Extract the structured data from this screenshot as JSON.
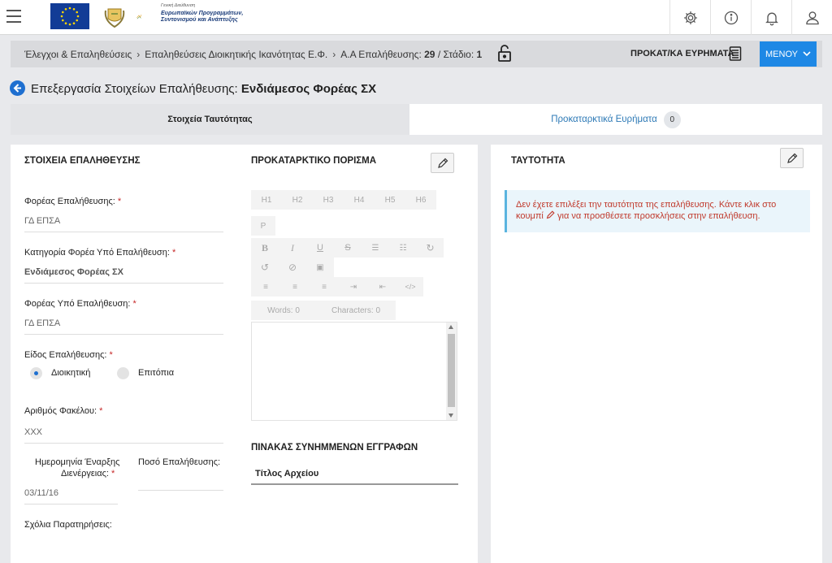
{
  "header": {
    "logo_lines": [
      "Γενική Διεύθυνση",
      "Ευρωπαϊκών Προγραμμάτων,",
      "Συντονισμού και Ανάπτυξης"
    ],
    "icons": [
      "menu-icon",
      "eu-flag-logo",
      "cyprus-emblem-logo",
      "settings-icon",
      "info-icon",
      "bell-icon",
      "user-icon"
    ]
  },
  "breadcrumb": {
    "item1": "Έλεγχοι & Επαληθεύσεις",
    "item2": "Επαληθεύσεις Διοικητικής Ικανότητας Ε.Φ.",
    "item3_prefix": "Α.Α Επαλήθευσης: ",
    "item3_number": "29",
    "item3_stage_label": " / Στάδιο: ",
    "item3_stage": "1",
    "findings_link": "ΠΡΟΚΑΤ/ΚΑ ΕΥΡΗΜΑΤΑ",
    "menu_button": "ΜΕΝΟΥ"
  },
  "page": {
    "title_prefix": "Επεξεργασία Στοιχείων Επαλήθευσης: ",
    "title_entity": "Ενδιάμεσος Φορέας ΣΧ"
  },
  "tabs": [
    {
      "label": "Στοιχεία Ταυτότητας",
      "active": true
    },
    {
      "label": "Προκαταρκτικά Ευρήματα",
      "count": "0",
      "active": false
    }
  ],
  "form": {
    "section_title": "ΣΤΟΙΧΕΙΑ ΕΠΑΛΗΘΕΥΣΗΣ",
    "carrier_label": "Φορέας Επαλήθευσης:",
    "carrier_value": "ΓΔ ΕΠΣΑ",
    "category_label": "Κατηγορία Φορέα Υπό Επαλήθευση:",
    "category_value": "Ενδιάμεσος Φορέας ΣΧ",
    "subject_label": "Φορέας Υπό Επαλήθευση:",
    "subject_value": "ΓΔ ΕΠΣΑ",
    "type_label": "Είδος Επαλήθευσης:",
    "type_options": [
      "Διοικητική",
      "Επιτόπια"
    ],
    "type_selected": "Διοικητική",
    "file_label": "Αριθμός Φακέλου:",
    "file_value": "XXX",
    "start_date_label_1": "Ημερομηνία Έναρξης",
    "start_date_label_2": "Διενέργειας:",
    "start_date_value": "03/11/16",
    "amount_label": "Ποσό Επαλήθευσης:",
    "amount_value": "",
    "comments_label": "Σχόλια Παρατηρήσεις:",
    "required_mark": "*"
  },
  "conclusion": {
    "section_title": "ΠΡΟΚΑΤΑΡΚΤΙΚΟ ΠΟΡΙΣΜΑ",
    "toolbar_headings": [
      "H1",
      "H2",
      "H3",
      "H4",
      "H5",
      "H6"
    ],
    "toolbar_paragraph": "P",
    "words": "Words: 0",
    "characters": "Characters: 0",
    "attachments_title": "ΠΙΝΑΚΑΣ ΣΥΝΗΜΜΕΝΩΝ ΕΓΓΡΑΦΩΝ",
    "attachments_column": "Τίτλος Αρχείου"
  },
  "identity": {
    "section_title": "ΤΑΥΤΟΤΗΤΑ",
    "alert_part1": "Δεν έχετε επιλέξει την ταυτότητα της επαλήθευσης. Κάντε κλικ στο κουμπί ",
    "alert_part2": " για να προσθέσετε προσκλήσεις στην επαλήθευση."
  },
  "colors": {
    "accent": "#1e88e5",
    "link": "#2e7ab6",
    "required": "#c62828",
    "alert_text": "#c0392b",
    "alert_bg": "#eaf5fb"
  }
}
